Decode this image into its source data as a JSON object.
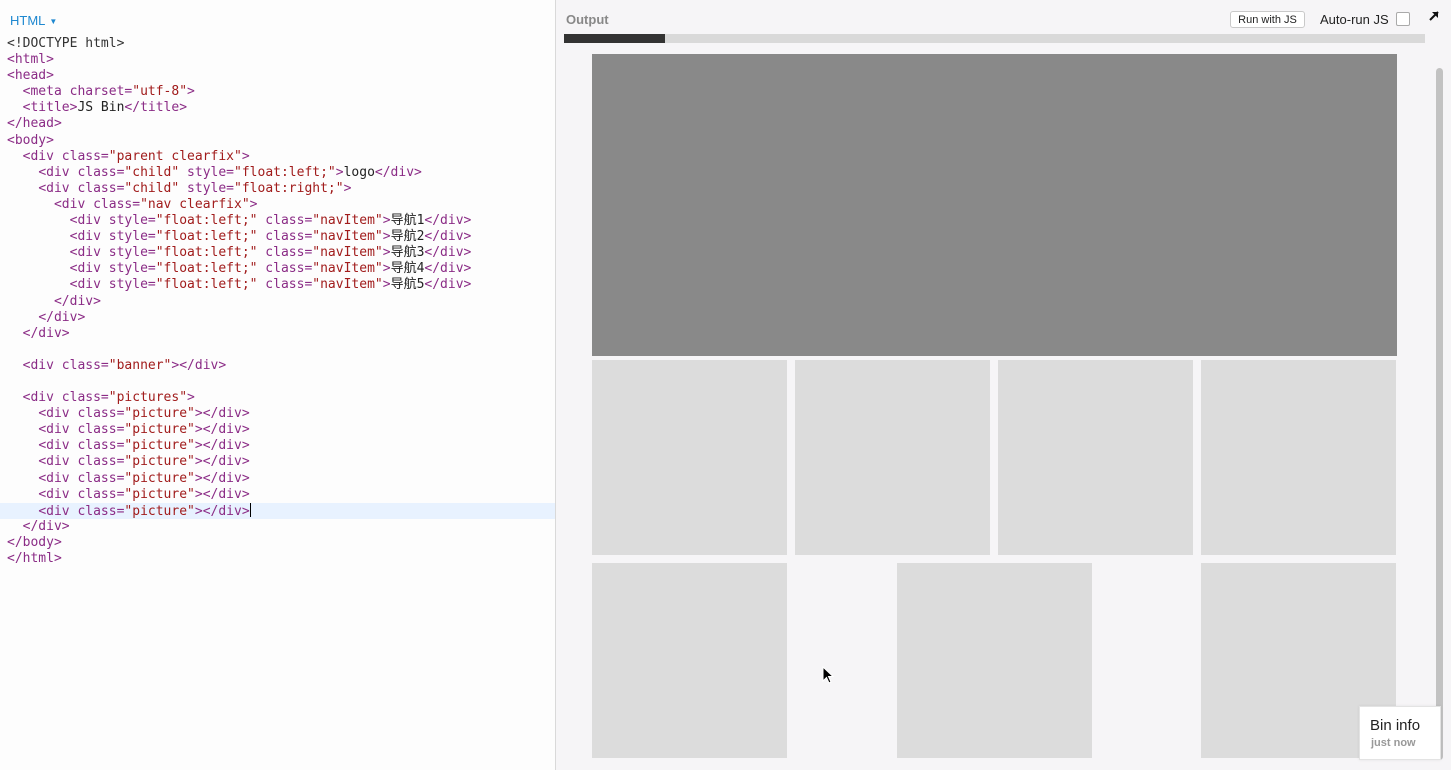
{
  "editor": {
    "panel_label": "HTML",
    "lines": [
      [
        {
          "t": "doctype",
          "v": "<!DOCTYPE html>"
        }
      ],
      [
        {
          "t": "tag",
          "v": "<html>"
        }
      ],
      [
        {
          "t": "tag",
          "v": "<head>"
        }
      ],
      [
        {
          "t": "txt",
          "v": "  "
        },
        {
          "t": "tag",
          "v": "<meta "
        },
        {
          "t": "attr",
          "v": "charset="
        },
        {
          "t": "str",
          "v": "\"utf-8\""
        },
        {
          "t": "tag",
          "v": ">"
        }
      ],
      [
        {
          "t": "txt",
          "v": "  "
        },
        {
          "t": "tag",
          "v": "<title>"
        },
        {
          "t": "txt",
          "v": "JS Bin"
        },
        {
          "t": "tag",
          "v": "</title>"
        }
      ],
      [
        {
          "t": "tag",
          "v": "</head>"
        }
      ],
      [
        {
          "t": "tag",
          "v": "<body>"
        }
      ],
      [
        {
          "t": "txt",
          "v": "  "
        },
        {
          "t": "tag",
          "v": "<div "
        },
        {
          "t": "attr",
          "v": "class="
        },
        {
          "t": "str",
          "v": "\"parent clearfix\""
        },
        {
          "t": "tag",
          "v": ">"
        }
      ],
      [
        {
          "t": "txt",
          "v": "    "
        },
        {
          "t": "tag",
          "v": "<div "
        },
        {
          "t": "attr",
          "v": "class="
        },
        {
          "t": "str",
          "v": "\"child\""
        },
        {
          "t": "attr",
          "v": " style="
        },
        {
          "t": "str",
          "v": "\"float:left;\""
        },
        {
          "t": "tag",
          "v": ">"
        },
        {
          "t": "txt",
          "v": "logo"
        },
        {
          "t": "tag",
          "v": "</div>"
        }
      ],
      [
        {
          "t": "txt",
          "v": "    "
        },
        {
          "t": "tag",
          "v": "<div "
        },
        {
          "t": "attr",
          "v": "class="
        },
        {
          "t": "str",
          "v": "\"child\""
        },
        {
          "t": "attr",
          "v": " style="
        },
        {
          "t": "str",
          "v": "\"float:right;\""
        },
        {
          "t": "tag",
          "v": ">"
        }
      ],
      [
        {
          "t": "txt",
          "v": "      "
        },
        {
          "t": "tag",
          "v": "<div "
        },
        {
          "t": "attr",
          "v": "class="
        },
        {
          "t": "str",
          "v": "\"nav clearfix\""
        },
        {
          "t": "tag",
          "v": ">"
        }
      ],
      [
        {
          "t": "txt",
          "v": "        "
        },
        {
          "t": "tag",
          "v": "<div "
        },
        {
          "t": "attr",
          "v": "style="
        },
        {
          "t": "str",
          "v": "\"float:left;\""
        },
        {
          "t": "attr",
          "v": " class="
        },
        {
          "t": "str",
          "v": "\"navItem\""
        },
        {
          "t": "tag",
          "v": ">"
        },
        {
          "t": "txt",
          "v": "导航1"
        },
        {
          "t": "tag",
          "v": "</div>"
        }
      ],
      [
        {
          "t": "txt",
          "v": "        "
        },
        {
          "t": "tag",
          "v": "<div "
        },
        {
          "t": "attr",
          "v": "style="
        },
        {
          "t": "str",
          "v": "\"float:left;\""
        },
        {
          "t": "attr",
          "v": " class="
        },
        {
          "t": "str",
          "v": "\"navItem\""
        },
        {
          "t": "tag",
          "v": ">"
        },
        {
          "t": "txt",
          "v": "导航2"
        },
        {
          "t": "tag",
          "v": "</div>"
        }
      ],
      [
        {
          "t": "txt",
          "v": "        "
        },
        {
          "t": "tag",
          "v": "<div "
        },
        {
          "t": "attr",
          "v": "style="
        },
        {
          "t": "str",
          "v": "\"float:left;\""
        },
        {
          "t": "attr",
          "v": " class="
        },
        {
          "t": "str",
          "v": "\"navItem\""
        },
        {
          "t": "tag",
          "v": ">"
        },
        {
          "t": "txt",
          "v": "导航3"
        },
        {
          "t": "tag",
          "v": "</div>"
        }
      ],
      [
        {
          "t": "txt",
          "v": "        "
        },
        {
          "t": "tag",
          "v": "<div "
        },
        {
          "t": "attr",
          "v": "style="
        },
        {
          "t": "str",
          "v": "\"float:left;\""
        },
        {
          "t": "attr",
          "v": " class="
        },
        {
          "t": "str",
          "v": "\"navItem\""
        },
        {
          "t": "tag",
          "v": ">"
        },
        {
          "t": "txt",
          "v": "导航4"
        },
        {
          "t": "tag",
          "v": "</div>"
        }
      ],
      [
        {
          "t": "txt",
          "v": "        "
        },
        {
          "t": "tag",
          "v": "<div "
        },
        {
          "t": "attr",
          "v": "style="
        },
        {
          "t": "str",
          "v": "\"float:left;\""
        },
        {
          "t": "attr",
          "v": " class="
        },
        {
          "t": "str",
          "v": "\"navItem\""
        },
        {
          "t": "tag",
          "v": ">"
        },
        {
          "t": "txt",
          "v": "导航5"
        },
        {
          "t": "tag",
          "v": "</div>"
        }
      ],
      [
        {
          "t": "txt",
          "v": "      "
        },
        {
          "t": "tag",
          "v": "</div>"
        }
      ],
      [
        {
          "t": "txt",
          "v": "    "
        },
        {
          "t": "tag",
          "v": "</div>"
        }
      ],
      [
        {
          "t": "txt",
          "v": "  "
        },
        {
          "t": "tag",
          "v": "</div>"
        }
      ],
      [],
      [
        {
          "t": "txt",
          "v": "  "
        },
        {
          "t": "tag",
          "v": "<div "
        },
        {
          "t": "attr",
          "v": "class="
        },
        {
          "t": "str",
          "v": "\"banner\""
        },
        {
          "t": "tag",
          "v": "></div>"
        }
      ],
      [],
      [
        {
          "t": "txt",
          "v": "  "
        },
        {
          "t": "tag",
          "v": "<div "
        },
        {
          "t": "attr",
          "v": "class="
        },
        {
          "t": "str",
          "v": "\"pictures\""
        },
        {
          "t": "tag",
          "v": ">"
        }
      ],
      [
        {
          "t": "txt",
          "v": "    "
        },
        {
          "t": "tag",
          "v": "<div "
        },
        {
          "t": "attr",
          "v": "class="
        },
        {
          "t": "str",
          "v": "\"picture\""
        },
        {
          "t": "tag",
          "v": "></div>"
        }
      ],
      [
        {
          "t": "txt",
          "v": "    "
        },
        {
          "t": "tag",
          "v": "<div "
        },
        {
          "t": "attr",
          "v": "class="
        },
        {
          "t": "str",
          "v": "\"picture\""
        },
        {
          "t": "tag",
          "v": "></div>"
        }
      ],
      [
        {
          "t": "txt",
          "v": "    "
        },
        {
          "t": "tag",
          "v": "<div "
        },
        {
          "t": "attr",
          "v": "class="
        },
        {
          "t": "str",
          "v": "\"picture\""
        },
        {
          "t": "tag",
          "v": "></div>"
        }
      ],
      [
        {
          "t": "txt",
          "v": "    "
        },
        {
          "t": "tag",
          "v": "<div "
        },
        {
          "t": "attr",
          "v": "class="
        },
        {
          "t": "str",
          "v": "\"picture\""
        },
        {
          "t": "tag",
          "v": "></div>"
        }
      ],
      [
        {
          "t": "txt",
          "v": "    "
        },
        {
          "t": "tag",
          "v": "<div "
        },
        {
          "t": "attr",
          "v": "class="
        },
        {
          "t": "str",
          "v": "\"picture\""
        },
        {
          "t": "tag",
          "v": "></div>"
        }
      ],
      [
        {
          "t": "txt",
          "v": "    "
        },
        {
          "t": "tag",
          "v": "<div "
        },
        {
          "t": "attr",
          "v": "class="
        },
        {
          "t": "str",
          "v": "\"picture\""
        },
        {
          "t": "tag",
          "v": "></div>"
        }
      ],
      [
        {
          "t": "txt",
          "v": "    "
        },
        {
          "t": "tag",
          "v": "<div "
        },
        {
          "t": "attr",
          "v": "class="
        },
        {
          "t": "str",
          "v": "\"picture\""
        },
        {
          "t": "tag",
          "v": "></div>"
        }
      ],
      [
        {
          "t": "txt",
          "v": "  "
        },
        {
          "t": "tag",
          "v": "</div>"
        }
      ],
      [
        {
          "t": "tag",
          "v": "</body>"
        }
      ],
      [
        {
          "t": "tag",
          "v": "</html>"
        }
      ]
    ],
    "active_line": 29
  },
  "output": {
    "title": "Output",
    "run_button_label": "Run with JS",
    "autorun_label": "Auto-run JS",
    "autorun_checked": false,
    "bin_info_title": "Bin info",
    "bin_info_subtitle": "just now"
  },
  "colors": {
    "tag": "#8b2c86",
    "string": "#a11c1c",
    "accent": "#1e88d0",
    "banner": "#898989",
    "picture": "#dcdcdc"
  },
  "icons": {
    "panel_dropdown": "chevron-down-icon",
    "popout": "arrow-up-right-icon",
    "mouse": "mouse-pointer-icon"
  }
}
